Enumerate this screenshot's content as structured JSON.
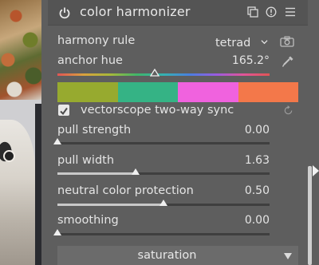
{
  "module": {
    "title": "color harmonizer",
    "icons": [
      "power-icon",
      "presets-icon",
      "reset-icon",
      "menu-icon"
    ]
  },
  "harmony_rule": {
    "label": "harmony rule",
    "value": "tetrad",
    "picker_icon": "camera-icon"
  },
  "anchor_hue": {
    "label": "anchor hue",
    "value": "165.2°",
    "fraction": 0.459,
    "picker_icon": "color-picker-icon"
  },
  "swatch_colors": [
    "#97aa2f",
    "#35b385",
    "#f062de",
    "#f3784a"
  ],
  "vectorscope": {
    "label": "vectorscope two-way sync",
    "checked": true,
    "reset_icon": "reset-icon"
  },
  "pull_strength": {
    "label": "pull strength",
    "value": "0.00",
    "fraction": 0.0
  },
  "pull_width": {
    "label": "pull width",
    "value": "1.63",
    "fraction": 0.37
  },
  "neutral_color_protection": {
    "label": "neutral color protection",
    "value": "0.50",
    "fraction": 0.5
  },
  "smoothing": {
    "label": "smoothing",
    "value": "0.00",
    "fraction": 0.0
  },
  "section": {
    "label": "saturation"
  }
}
